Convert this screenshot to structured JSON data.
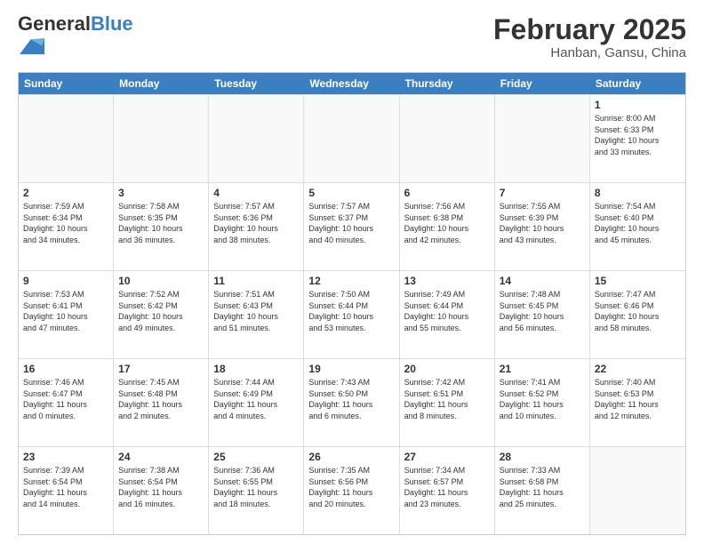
{
  "header": {
    "logo_general": "General",
    "logo_blue": "Blue",
    "month_title": "February 2025",
    "location": "Hanban, Gansu, China"
  },
  "days_of_week": [
    "Sunday",
    "Monday",
    "Tuesday",
    "Wednesday",
    "Thursday",
    "Friday",
    "Saturday"
  ],
  "weeks": [
    [
      {
        "day": "",
        "info": ""
      },
      {
        "day": "",
        "info": ""
      },
      {
        "day": "",
        "info": ""
      },
      {
        "day": "",
        "info": ""
      },
      {
        "day": "",
        "info": ""
      },
      {
        "day": "",
        "info": ""
      },
      {
        "day": "1",
        "info": "Sunrise: 8:00 AM\nSunset: 6:33 PM\nDaylight: 10 hours\nand 33 minutes."
      }
    ],
    [
      {
        "day": "2",
        "info": "Sunrise: 7:59 AM\nSunset: 6:34 PM\nDaylight: 10 hours\nand 34 minutes."
      },
      {
        "day": "3",
        "info": "Sunrise: 7:58 AM\nSunset: 6:35 PM\nDaylight: 10 hours\nand 36 minutes."
      },
      {
        "day": "4",
        "info": "Sunrise: 7:57 AM\nSunset: 6:36 PM\nDaylight: 10 hours\nand 38 minutes."
      },
      {
        "day": "5",
        "info": "Sunrise: 7:57 AM\nSunset: 6:37 PM\nDaylight: 10 hours\nand 40 minutes."
      },
      {
        "day": "6",
        "info": "Sunrise: 7:56 AM\nSunset: 6:38 PM\nDaylight: 10 hours\nand 42 minutes."
      },
      {
        "day": "7",
        "info": "Sunrise: 7:55 AM\nSunset: 6:39 PM\nDaylight: 10 hours\nand 43 minutes."
      },
      {
        "day": "8",
        "info": "Sunrise: 7:54 AM\nSunset: 6:40 PM\nDaylight: 10 hours\nand 45 minutes."
      }
    ],
    [
      {
        "day": "9",
        "info": "Sunrise: 7:53 AM\nSunset: 6:41 PM\nDaylight: 10 hours\nand 47 minutes."
      },
      {
        "day": "10",
        "info": "Sunrise: 7:52 AM\nSunset: 6:42 PM\nDaylight: 10 hours\nand 49 minutes."
      },
      {
        "day": "11",
        "info": "Sunrise: 7:51 AM\nSunset: 6:43 PM\nDaylight: 10 hours\nand 51 minutes."
      },
      {
        "day": "12",
        "info": "Sunrise: 7:50 AM\nSunset: 6:44 PM\nDaylight: 10 hours\nand 53 minutes."
      },
      {
        "day": "13",
        "info": "Sunrise: 7:49 AM\nSunset: 6:44 PM\nDaylight: 10 hours\nand 55 minutes."
      },
      {
        "day": "14",
        "info": "Sunrise: 7:48 AM\nSunset: 6:45 PM\nDaylight: 10 hours\nand 56 minutes."
      },
      {
        "day": "15",
        "info": "Sunrise: 7:47 AM\nSunset: 6:46 PM\nDaylight: 10 hours\nand 58 minutes."
      }
    ],
    [
      {
        "day": "16",
        "info": "Sunrise: 7:46 AM\nSunset: 6:47 PM\nDaylight: 11 hours\nand 0 minutes."
      },
      {
        "day": "17",
        "info": "Sunrise: 7:45 AM\nSunset: 6:48 PM\nDaylight: 11 hours\nand 2 minutes."
      },
      {
        "day": "18",
        "info": "Sunrise: 7:44 AM\nSunset: 6:49 PM\nDaylight: 11 hours\nand 4 minutes."
      },
      {
        "day": "19",
        "info": "Sunrise: 7:43 AM\nSunset: 6:50 PM\nDaylight: 11 hours\nand 6 minutes."
      },
      {
        "day": "20",
        "info": "Sunrise: 7:42 AM\nSunset: 6:51 PM\nDaylight: 11 hours\nand 8 minutes."
      },
      {
        "day": "21",
        "info": "Sunrise: 7:41 AM\nSunset: 6:52 PM\nDaylight: 11 hours\nand 10 minutes."
      },
      {
        "day": "22",
        "info": "Sunrise: 7:40 AM\nSunset: 6:53 PM\nDaylight: 11 hours\nand 12 minutes."
      }
    ],
    [
      {
        "day": "23",
        "info": "Sunrise: 7:39 AM\nSunset: 6:54 PM\nDaylight: 11 hours\nand 14 minutes."
      },
      {
        "day": "24",
        "info": "Sunrise: 7:38 AM\nSunset: 6:54 PM\nDaylight: 11 hours\nand 16 minutes."
      },
      {
        "day": "25",
        "info": "Sunrise: 7:36 AM\nSunset: 6:55 PM\nDaylight: 11 hours\nand 18 minutes."
      },
      {
        "day": "26",
        "info": "Sunrise: 7:35 AM\nSunset: 6:56 PM\nDaylight: 11 hours\nand 20 minutes."
      },
      {
        "day": "27",
        "info": "Sunrise: 7:34 AM\nSunset: 6:57 PM\nDaylight: 11 hours\nand 23 minutes."
      },
      {
        "day": "28",
        "info": "Sunrise: 7:33 AM\nSunset: 6:58 PM\nDaylight: 11 hours\nand 25 minutes."
      },
      {
        "day": "",
        "info": ""
      }
    ]
  ]
}
